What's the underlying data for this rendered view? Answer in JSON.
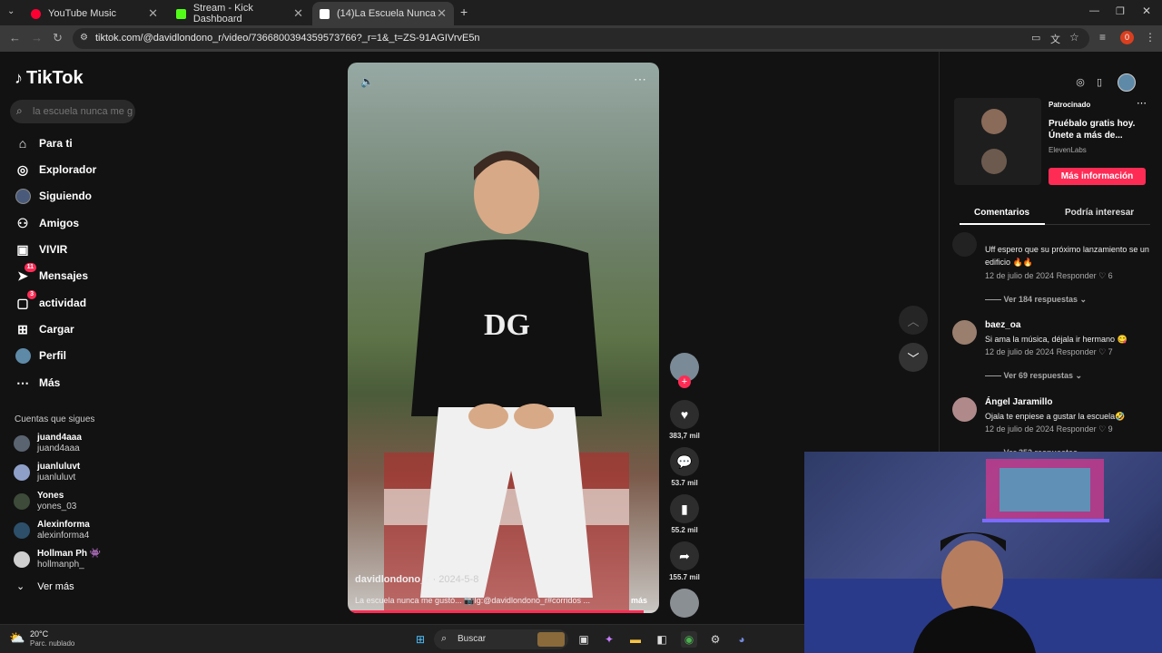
{
  "browser": {
    "tabs": [
      {
        "label": "YouTube Music",
        "color": "#ff0033"
      },
      {
        "label": "Stream - Kick Dashboard",
        "color": "#53fc18"
      },
      {
        "label": "(14)La Escuela Nunca Me G",
        "color": "#ffffff"
      }
    ],
    "url": "tiktok.com/@davidlondono_r/video/7366800394359573766?_r=1&_t=ZS-91AGIVrvE5n",
    "profile_badge": "0"
  },
  "sidebar": {
    "logo": "TikTok",
    "search_placeholder": "la escuela nunca me g...",
    "nav": [
      {
        "label": "Para ti",
        "icon": "home-icon"
      },
      {
        "label": "Explorador",
        "icon": "compass-icon"
      },
      {
        "label": "Siguiendo",
        "icon": "following-icon"
      },
      {
        "label": "Amigos",
        "icon": "friends-icon"
      },
      {
        "label": "VIVIR",
        "icon": "live-icon"
      },
      {
        "label": "Mensajes",
        "icon": "messages-icon",
        "badge": "11"
      },
      {
        "label": "actividad",
        "icon": "activity-icon",
        "badge": "3"
      },
      {
        "label": "Cargar",
        "icon": "upload-icon"
      },
      {
        "label": "Perfil",
        "icon": "profile-icon"
      },
      {
        "label": "Más",
        "icon": "more-icon"
      }
    ],
    "following_title": "Cuentas que sigues",
    "accounts": [
      {
        "name": "juand4aaa",
        "handle": "juand4aaa"
      },
      {
        "name": "juanluluvt",
        "handle": "juanluluvt"
      },
      {
        "name": "Yones",
        "handle": "yones_03"
      },
      {
        "name": "Alexinforma",
        "handle": "alexinforma4"
      },
      {
        "name": "Hollman Ph",
        "handle": "hollmanph_"
      }
    ],
    "see_more": "Ver más"
  },
  "video": {
    "author": "davidlondono_r",
    "date": "· 2024-5-8",
    "caption": "La escuela nunca me gustó... 📷Ig:@davidlondono_r#corridos ...",
    "more": "más",
    "progress": 0.95
  },
  "actions": {
    "likes": "383,7 mil",
    "comments": "53.7 mil",
    "saves": "55.2 mil",
    "shares": "155.7 mil"
  },
  "ad": {
    "label": "Patrocinado",
    "text": "Pruébalo gratis hoy. Únete a más de...",
    "brand": "ElevenLabs",
    "cta": "Más información"
  },
  "comments_tabs": [
    "Comentarios",
    "Podría interesar"
  ],
  "comments": [
    {
      "user": "",
      "text": "Uff espero que su próximo lanzamiento se un edificio 🔥🔥",
      "meta": "12 de julio de 2024     Responder ♡ 6",
      "replies": "——  Ver 184 respuestas ⌄"
    },
    {
      "user": "baez_oa",
      "text": "Si ama la música, déjala ir hermano 😋",
      "meta": "12 de julio de 2024     Responder ♡ 7",
      "replies": "——  Ver 69 respuestas ⌄"
    },
    {
      "user": "Ángel Jaramillo",
      "text": "Ojala te enpiese a gustar la escuela🤣",
      "meta": "12 de julio de 2024     Responder ♡ 9",
      "replies": "——  Ver 352 respuestas ⌄"
    }
  ],
  "taskbar": {
    "temp": "20°C",
    "weather": "Parc. nublado",
    "search": "Buscar"
  },
  "colors": {
    "accent": "#fe2c55"
  }
}
